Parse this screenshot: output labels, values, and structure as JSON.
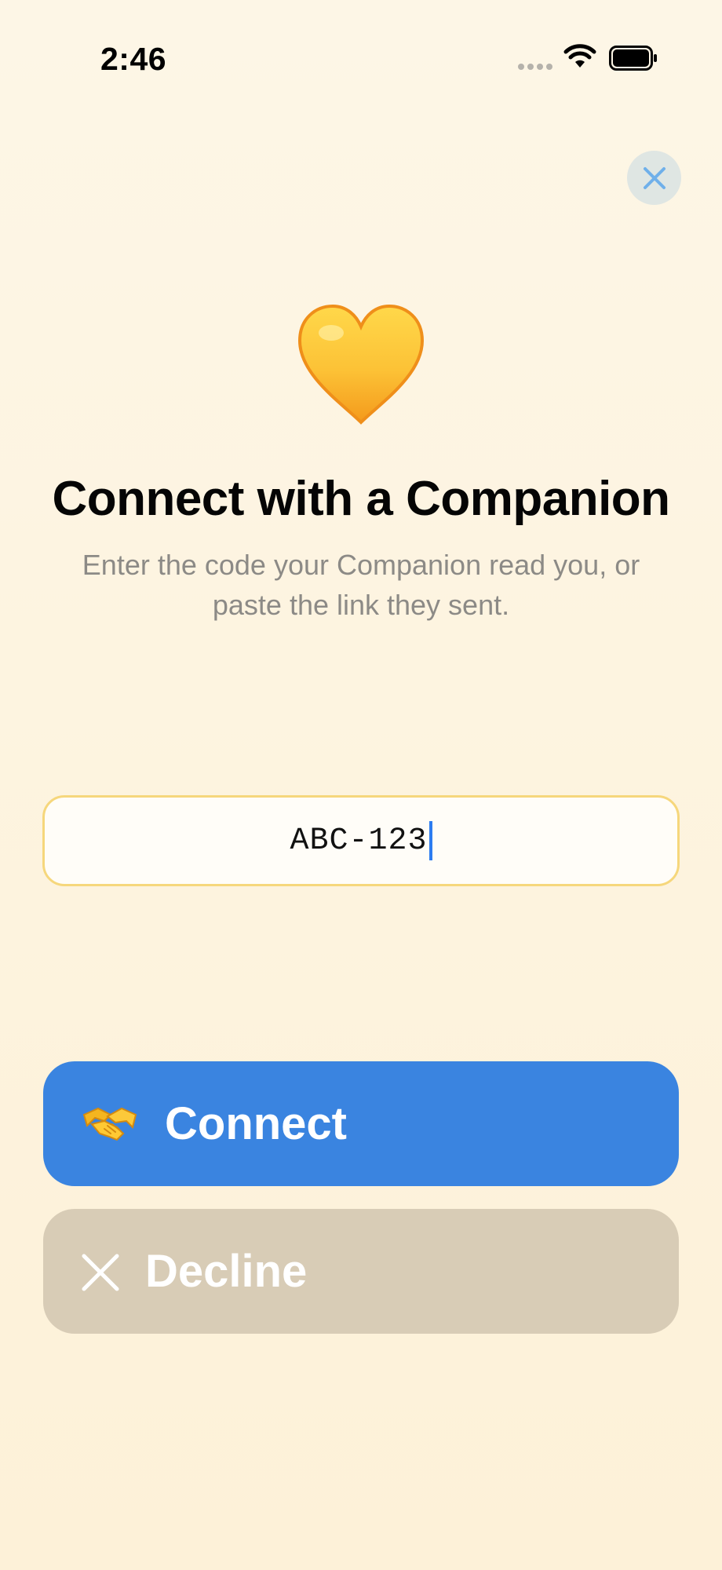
{
  "status_bar": {
    "time": "2:46",
    "icons": [
      "signal-icon",
      "wifi-icon",
      "battery-icon"
    ]
  },
  "header": {
    "close_icon": "close-icon"
  },
  "hero": {
    "icon": "yellow-heart-icon",
    "title": "Connect with a Companion",
    "subtitle": "Enter the code your Companion read you, or paste the link they sent."
  },
  "code_field": {
    "value": "ABC-123"
  },
  "actions": {
    "connect_label": "Connect",
    "connect_icon": "handshake-icon",
    "decline_label": "Decline",
    "decline_icon": "x-icon"
  },
  "colors": {
    "primary": "#3a84e0",
    "secondary": "#d8ccb6",
    "field_border": "#f6d77c",
    "background": "#fdf4e0",
    "cursor": "#2d7cf0"
  }
}
